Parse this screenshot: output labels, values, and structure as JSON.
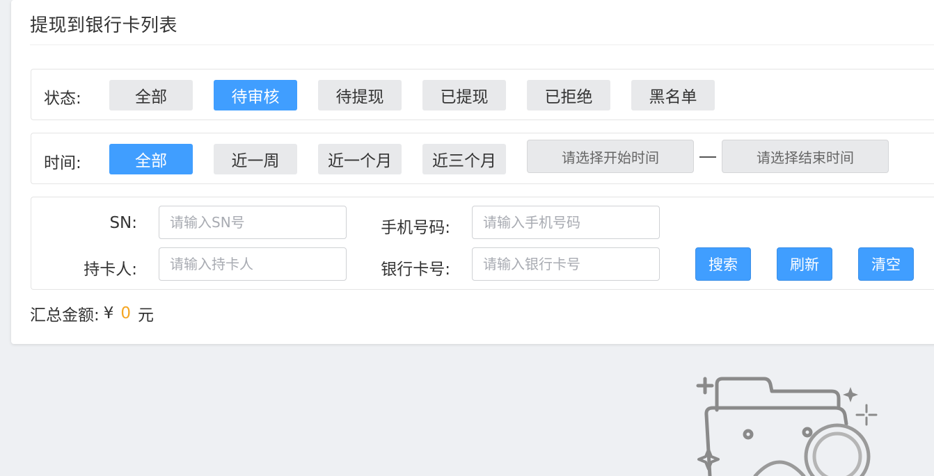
{
  "page": {
    "title": "提现到银行卡列表"
  },
  "status_filter": {
    "label": "状态:",
    "options": [
      "全部",
      "待审核",
      "待提现",
      "已提现",
      "已拒绝",
      "黑名单"
    ],
    "selected": "待审核"
  },
  "time_filter": {
    "label": "时间:",
    "options": [
      "全部",
      "近一周",
      "近一个月",
      "近三个月"
    ],
    "selected": "全部",
    "start_placeholder": "请选择开始时间",
    "end_placeholder": "请选择结束时间"
  },
  "search": {
    "sn_label": "SN:",
    "sn_placeholder": "请输入SN号",
    "phone_label": "手机号码:",
    "phone_placeholder": "请输入手机号码",
    "holder_label": "持卡人:",
    "holder_placeholder": "请输入持卡人",
    "card_label": "银行卡号:",
    "card_placeholder": "请输入银行卡号",
    "search_button": "搜索",
    "refresh_button": "刷新",
    "clear_button": "清空"
  },
  "summary": {
    "label": "汇总金额:",
    "currency": "¥",
    "amount": "0",
    "unit": "元"
  },
  "colors": {
    "accent": "#409eff",
    "amount": "#f5a623",
    "background": "#eef0f3"
  },
  "icons": [
    "empty-folder-illustration",
    "sparkle-icon"
  ]
}
